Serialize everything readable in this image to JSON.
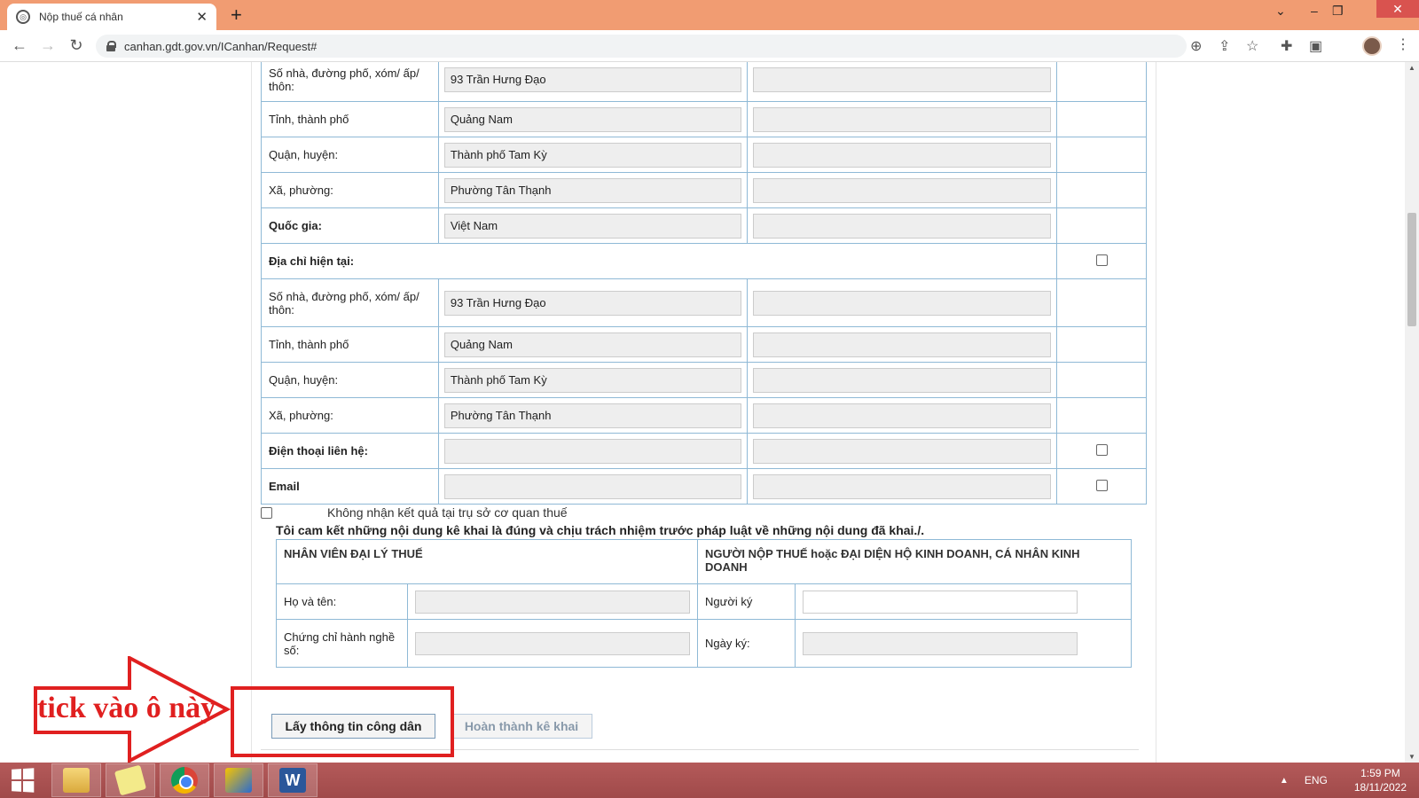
{
  "browser": {
    "tab_title": "Nộp thuế cá nhân",
    "url": "canhan.gdt.gov.vn/ICanhan/Request#"
  },
  "form": {
    "permanent_rows": [
      {
        "label": "Số nhà, đường phố, xóm/ ấp/ thôn:",
        "value": "93 Trần Hưng Đạo"
      },
      {
        "label": "Tỉnh, thành phố",
        "value": "Quảng Nam"
      },
      {
        "label": "Quận, huyện:",
        "value": "Thành phố Tam Kỳ"
      },
      {
        "label": "Xã, phường:",
        "value": "Phường Tân Thạnh"
      },
      {
        "label": "Quốc gia:",
        "value": "Việt Nam"
      }
    ],
    "current_address_label": "Địa chỉ hiện tại:",
    "current_rows": [
      {
        "label": "Số nhà, đường phố, xóm/ ấp/ thôn:",
        "value": "93 Trần Hưng Đạo"
      },
      {
        "label": "Tỉnh, thành phố",
        "value": "Quảng Nam"
      },
      {
        "label": "Quận, huyện:",
        "value": "Thành phố Tam Kỳ"
      },
      {
        "label": "Xã, phường:",
        "value": "Phường Tân Thạnh"
      }
    ],
    "phone_label": "Điện thoại liên hệ:",
    "email_label": "Email",
    "no_delivery_label": "Không nhận kết quả tại trụ sở cơ quan thuế",
    "commitment": "Tôi cam kết những nội dung kê khai là đúng và chịu trách nhiệm trước pháp luật về những nội dung đã khai./."
  },
  "signature": {
    "agent_header": "NHÂN VIÊN ĐẠI LÝ THUẾ",
    "payer_header": "NGƯỜI NỘP THUẾ hoặc ĐẠI DIỆN HỘ KINH DOANH, CÁ NHÂN KINH DOANH",
    "name_label": "Họ và tên:",
    "cert_label": "Chứng chỉ hành nghề số:",
    "signer_label": "Người ký",
    "date_label": "Ngày ký:"
  },
  "buttons": {
    "get_info": "Lấy thông tin công dân",
    "complete": "Hoàn thành kê khai"
  },
  "annotation": {
    "text": "tick vào ô này",
    "color": "#e02020"
  },
  "taskbar": {
    "language": "ENG",
    "time": "1:59 PM",
    "date": "18/11/2022"
  },
  "colors": {
    "tab_strip": "#f19c72",
    "table_border": "#8fb9d6",
    "taskbar": "#a04a4a"
  }
}
